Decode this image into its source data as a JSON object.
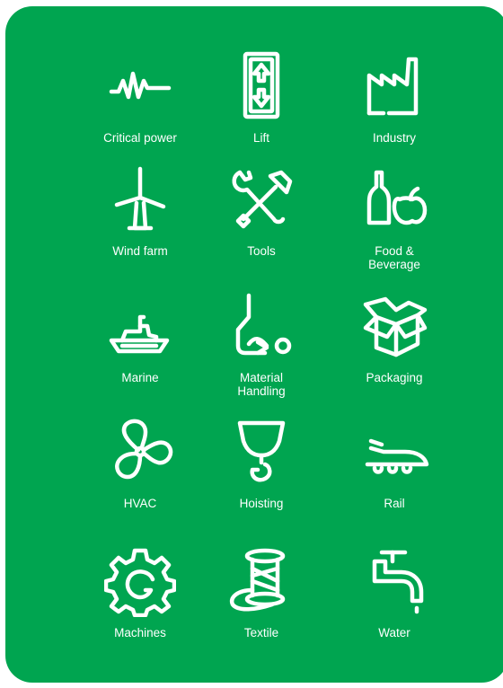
{
  "colors": {
    "background": "#00a550",
    "foreground": "#ffffff"
  },
  "tiles": [
    {
      "label": "Critical power",
      "icon": "pulse-waveform-icon"
    },
    {
      "label": "Lift",
      "icon": "elevator-icon"
    },
    {
      "label": "Industry",
      "icon": "factory-icon"
    },
    {
      "label": "Wind farm",
      "icon": "wind-turbine-icon"
    },
    {
      "label": "Tools",
      "icon": "wrench-hammer-icon"
    },
    {
      "label": "Food &\nBeverage",
      "icon": "bottle-apple-icon"
    },
    {
      "label": "Marine",
      "icon": "ship-icon"
    },
    {
      "label": "Material\nHandling",
      "icon": "hand-truck-icon"
    },
    {
      "label": "Packaging",
      "icon": "open-box-icon"
    },
    {
      "label": "HVAC",
      "icon": "fan-icon"
    },
    {
      "label": "Hoisting",
      "icon": "crane-hook-icon"
    },
    {
      "label": "Rail",
      "icon": "high-speed-train-icon"
    },
    {
      "label": "Machines",
      "icon": "gear-icon"
    },
    {
      "label": "Textile",
      "icon": "thread-spool-icon"
    },
    {
      "label": "Water",
      "icon": "water-tap-icon"
    }
  ]
}
